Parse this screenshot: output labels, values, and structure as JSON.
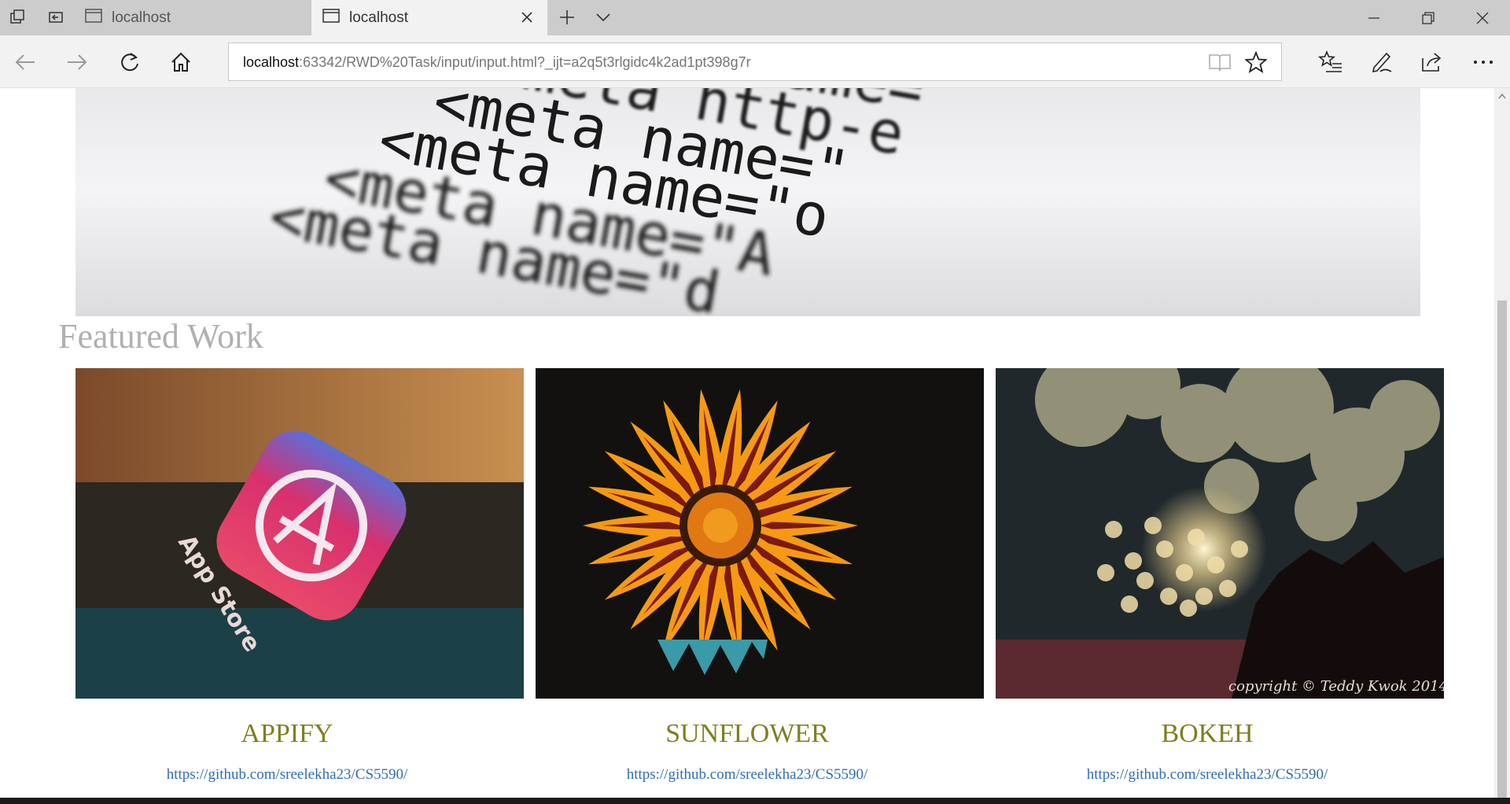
{
  "browser": {
    "tabs": [
      {
        "title": "localhost",
        "active": false
      },
      {
        "title": "localhost",
        "active": true
      }
    ],
    "address": {
      "host": "localhost",
      "rest": ":63342/RWD%20Task/input/input.html?_ijt=a2q5t3rlgidc4k2ad1pt398g7r"
    }
  },
  "page": {
    "hero_code_lines": [
      "<meta name=",
      "<meta http-e",
      "<meta name=\"",
      "<meta name=\"o",
      "<meta name=\"A",
      "<meta name=\"d"
    ],
    "section_title": "Featured Work",
    "cards": [
      {
        "title": "APPIFY",
        "link": "https://github.com/sreelekha23/CS5590/",
        "image_label": "App Store"
      },
      {
        "title": "SUNFLOWER",
        "link": "https://github.com/sreelekha23/CS5590/"
      },
      {
        "title": "BOKEH",
        "link": "https://github.com/sreelekha23/CS5590/",
        "image_credit": "copyright © Teddy Kwok 2014"
      }
    ]
  },
  "colors": {
    "section_title": "#b0b0b0",
    "card_title": "#7f7f1f",
    "link": "#2f6db5"
  }
}
